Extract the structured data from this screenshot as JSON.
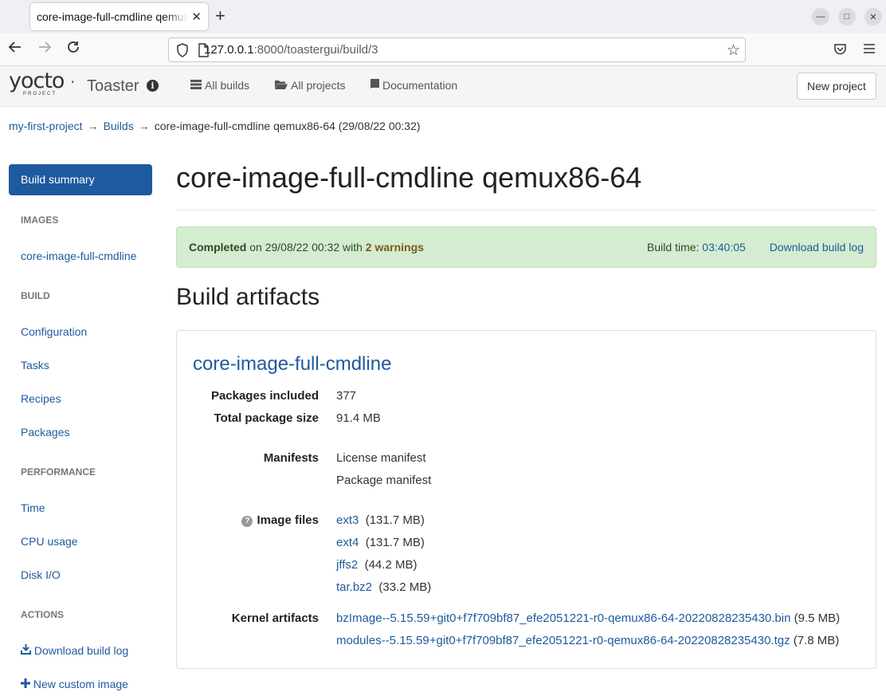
{
  "browser": {
    "tab_title": "core-image-full-cmdline qemux86-64",
    "url_host": "127.0.0.1",
    "url_rest": ":8000/toastergui/build/3"
  },
  "app": {
    "logo_text": "yocto",
    "logo_sub": "PROJECT",
    "title": "Toaster",
    "nav": [
      "All builds",
      "All projects",
      "Documentation"
    ],
    "new_project": "New project"
  },
  "breadcrumb": {
    "project": "my-first-project",
    "builds": "Builds",
    "current": "core-image-full-cmdline qemux86-64 (29/08/22 00:32)",
    "arrow": "→"
  },
  "sidebar": {
    "active": "Build summary",
    "sections": {
      "images": "IMAGES",
      "build": "BUILD",
      "performance": "PERFORMANCE",
      "actions": "ACTIONS"
    },
    "image_items": [
      "core-image-full-cmdline"
    ],
    "build_items": [
      "Configuration",
      "Tasks",
      "Recipes",
      "Packages"
    ],
    "performance_items": [
      "Time",
      "CPU usage",
      "Disk I/O"
    ],
    "actions": [
      "Download build log",
      "New custom image"
    ]
  },
  "main": {
    "title": "core-image-full-cmdline qemux86-64",
    "alert": {
      "status": "Completed",
      "on_text": "on 29/08/22 00:32 with",
      "warnings": "2 warnings",
      "build_time_label": "Build time:",
      "build_time": "03:40:05",
      "download_log": "Download build log"
    },
    "artifacts_heading": "Build artifacts",
    "image_name": "core-image-full-cmdline",
    "packages_label": "Packages included",
    "packages_count": "377",
    "size_label": "Total package size",
    "size_value": "91.4 MB",
    "manifests_label": "Manifests",
    "manifests": [
      "License manifest",
      "Package manifest"
    ],
    "image_files_label": "Image files",
    "image_files": [
      {
        "name": "ext3",
        "size": "(131.7 MB)"
      },
      {
        "name": "ext4",
        "size": "(131.7 MB)"
      },
      {
        "name": "jffs2",
        "size": "(44.2 MB)"
      },
      {
        "name": "tar.bz2",
        "size": "(33.2 MB)"
      }
    ],
    "kernel_label": "Kernel artifacts",
    "kernel_artifacts": [
      {
        "name": "bzImage--5.15.59+git0+f7f709bf87_efe2051221-r0-qemux86-64-20220828235430.bin",
        "size": "(9.5 MB)"
      },
      {
        "name": "modules--5.15.59+git0+f7f709bf87_efe2051221-r0-qemux86-64-20220828235430.tgz",
        "size": "(7.8 MB)"
      }
    ]
  }
}
